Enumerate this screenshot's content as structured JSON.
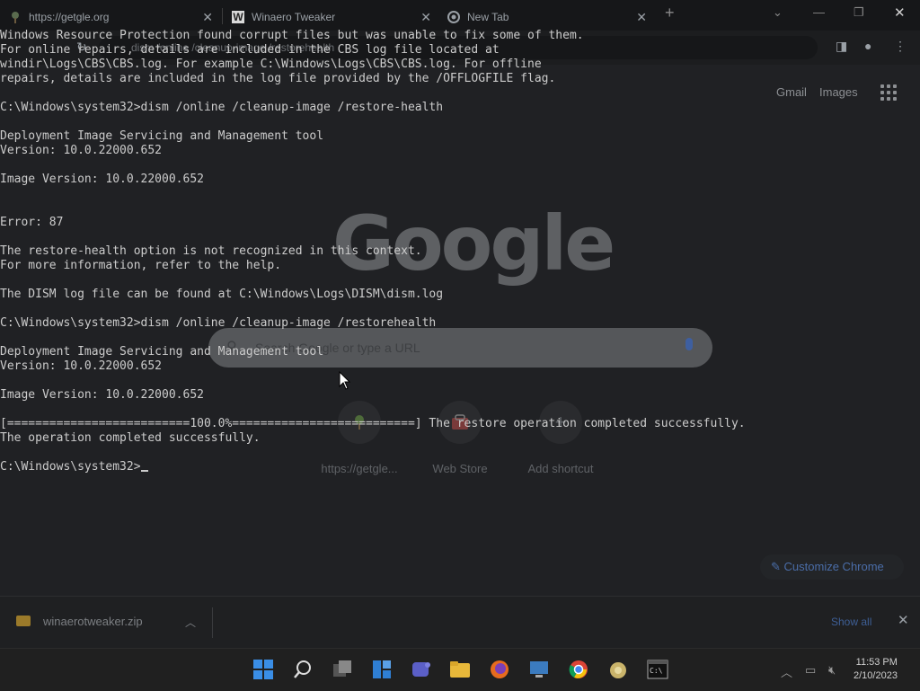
{
  "chrome": {
    "tabs": [
      {
        "title": "https://getgle.org",
        "close": "✕"
      },
      {
        "title": "Winaero Tweaker",
        "close": "✕"
      },
      {
        "title": "New Tab",
        "close": "✕"
      }
    ],
    "new_tab": "+",
    "omnibox_text": "dism /online /cleanup-image /restorehealth",
    "links": {
      "gmail": "Gmail",
      "images": "Images"
    },
    "logo": "Google",
    "search_placeholder": "Search Google or type a URL",
    "shortcuts": [
      {
        "label": "https://getgle..."
      },
      {
        "label": "Web Store"
      },
      {
        "label": "Add shortcut"
      }
    ],
    "customize_label": "Customize Chrome"
  },
  "console": {
    "lines": [
      "Windows Resource Protection found corrupt files but was unable to fix some of them.",
      "For online repairs, details are included in the CBS log file located at",
      "windir\\Logs\\CBS\\CBS.log. For example C:\\Windows\\Logs\\CBS\\CBS.log. For offline",
      "repairs, details are included in the log file provided by the /OFFLOGFILE flag.",
      "",
      "C:\\Windows\\system32>dism /online /cleanup-image /restore-health",
      "",
      "Deployment Image Servicing and Management tool",
      "Version: 10.0.22000.652",
      "",
      "Image Version: 10.0.22000.652",
      "",
      "",
      "Error: 87",
      "",
      "The restore-health option is not recognized in this context.",
      "For more information, refer to the help.",
      "",
      "The DISM log file can be found at C:\\Windows\\Logs\\DISM\\dism.log",
      "",
      "C:\\Windows\\system32>dism /online /cleanup-image /restorehealth",
      "",
      "Deployment Image Servicing and Management tool",
      "Version: 10.0.22000.652",
      "",
      "Image Version: 10.0.22000.652",
      "",
      "[==========================100.0%==========================] The restore operation completed successfully.",
      "The operation completed successfully.",
      ""
    ],
    "prompt": "C:\\Windows\\system32>"
  },
  "downloads": {
    "file": "winaerotweaker.zip",
    "show_all": "Show all",
    "close": "✕"
  },
  "taskbar": {
    "time": "11:53 PM",
    "date": "2/10/2023"
  },
  "colors": {
    "console_text": "#cccccc",
    "accent_blue": "#3e5f96"
  }
}
